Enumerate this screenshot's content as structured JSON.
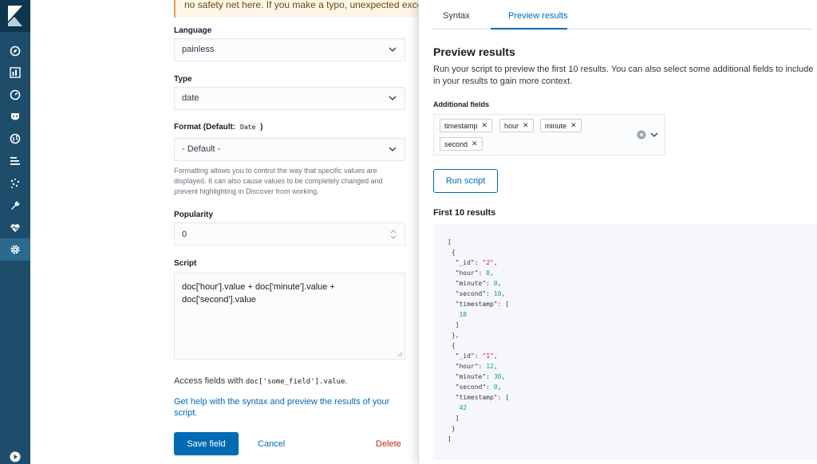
{
  "nav": {
    "icons": [
      "kibana-logo-icon",
      "discover-compass-icon",
      "visualize-chart-icon",
      "dashboard-gauge-icon",
      "canvas-mask-icon",
      "maps-globe-icon",
      "logs-list-icon",
      "ml-sparkle-icon",
      "dev-tools-wrench-icon",
      "monitoring-heart-icon",
      "management-gear-icon",
      "play-icon"
    ],
    "active": "management-gear-icon"
  },
  "form": {
    "callout_text": "no safety net here. If you make a typo, unexpected exceptions",
    "language_label": "Language",
    "language_value": "painless",
    "type_label": "Type",
    "type_value": "date",
    "format_label_prefix": "Format (Default:",
    "format_default_code": "Date",
    "format_label_suffix": ")",
    "format_value": "- Default -",
    "format_help": "Formatting allows you to control the way that specific values are displayed. It can also cause values to be completely changed and prevent highlighting in Discover from working.",
    "popularity_label": "Popularity",
    "popularity_value": "0",
    "script_label": "Script",
    "script_value": "doc['hour'].value + doc['minute'].value + doc['second'].value",
    "access_prefix": "Access fields with",
    "access_code": "doc['some_field'].value",
    "access_suffix": ".",
    "help_link": "Get help with the syntax and preview the results of your script.",
    "save_label": "Save field",
    "cancel_label": "Cancel",
    "delete_label": "Delete"
  },
  "flyout": {
    "tabs": [
      "Syntax",
      "Preview results"
    ],
    "active_tab": "Preview results",
    "title": "Preview results",
    "description": "Run your script to preview the first 10 results. You can also select some additional fields to include in your results to gain more context.",
    "additional_fields_label": "Additional fields",
    "fields": [
      "timestamp",
      "hour",
      "minute",
      "second"
    ],
    "run_label": "Run script",
    "results_label": "First 10 results",
    "results": [
      {
        "_id": "2",
        "hour": 8,
        "minute": 0,
        "second": 10,
        "timestamp": [
          18
        ]
      },
      {
        "_id": "1",
        "hour": 12,
        "minute": 30,
        "second": 0,
        "timestamp": [
          42
        ]
      }
    ]
  },
  "colors": {
    "nav_bg": "#1d4d6b",
    "primary": "#006bb4",
    "danger": "#bd271e",
    "code_string": "#dd0a73",
    "code_number": "#00a69b"
  }
}
